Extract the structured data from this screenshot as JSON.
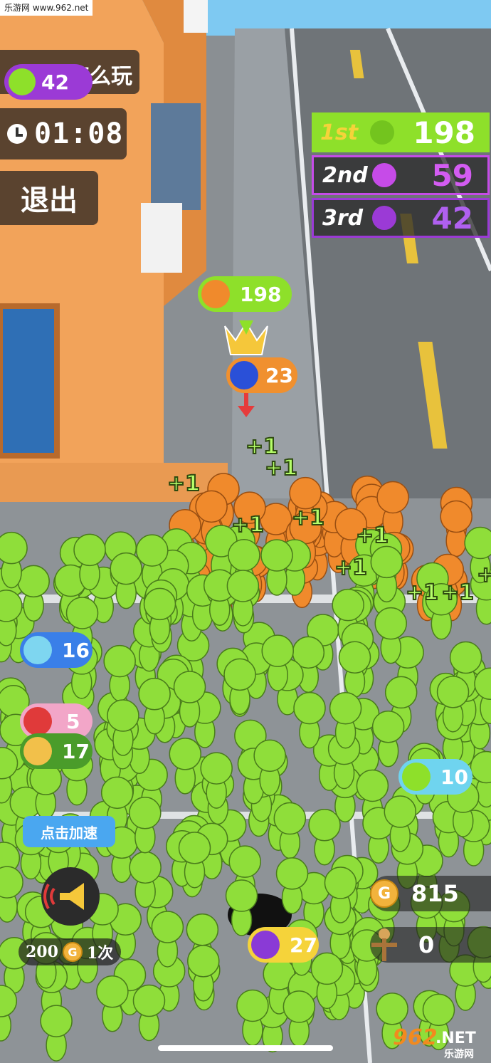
{
  "watermark": {
    "text": "乐游网 www.962.net"
  },
  "hud": {
    "mode_title": "怎么玩",
    "self_count": "42",
    "timer": "01:08",
    "exit_label": "退出"
  },
  "leaderboard": [
    {
      "rank": "1st",
      "score": "198",
      "color": "#8ee02a"
    },
    {
      "rank": "2nd",
      "score": "59",
      "color": "#c64be8"
    },
    {
      "rank": "3rd",
      "score": "42",
      "color": "#9b3ad6"
    }
  ],
  "crowd_tags": {
    "leader_score": "198",
    "blue_score": "23",
    "cyan_score": "16",
    "red_score": "5",
    "green_score": "17",
    "teal_score": "10",
    "purple_score": "27"
  },
  "floating_plus": [
    "+1",
    "+1",
    "+1",
    "+1",
    "+1",
    "+1",
    "+1",
    "+1",
    "+1",
    "+1"
  ],
  "boost": {
    "tip": "点击加速",
    "cost": "200",
    "uses": "1次",
    "coin_symbol": "G"
  },
  "resources": {
    "coins": "815",
    "items": "0"
  },
  "logo": {
    "main": "962",
    "suffix": ".NET",
    "sub": "乐游网"
  },
  "colors": {
    "crowd_green": "#8fde3a",
    "orange_crowd": "#f08a2c",
    "road": "#6f7478"
  },
  "icons": [
    "clock-icon",
    "megaphone-icon",
    "coin-icon",
    "scarecrow-icon",
    "crown-icon",
    "arrow-down-icon"
  ]
}
